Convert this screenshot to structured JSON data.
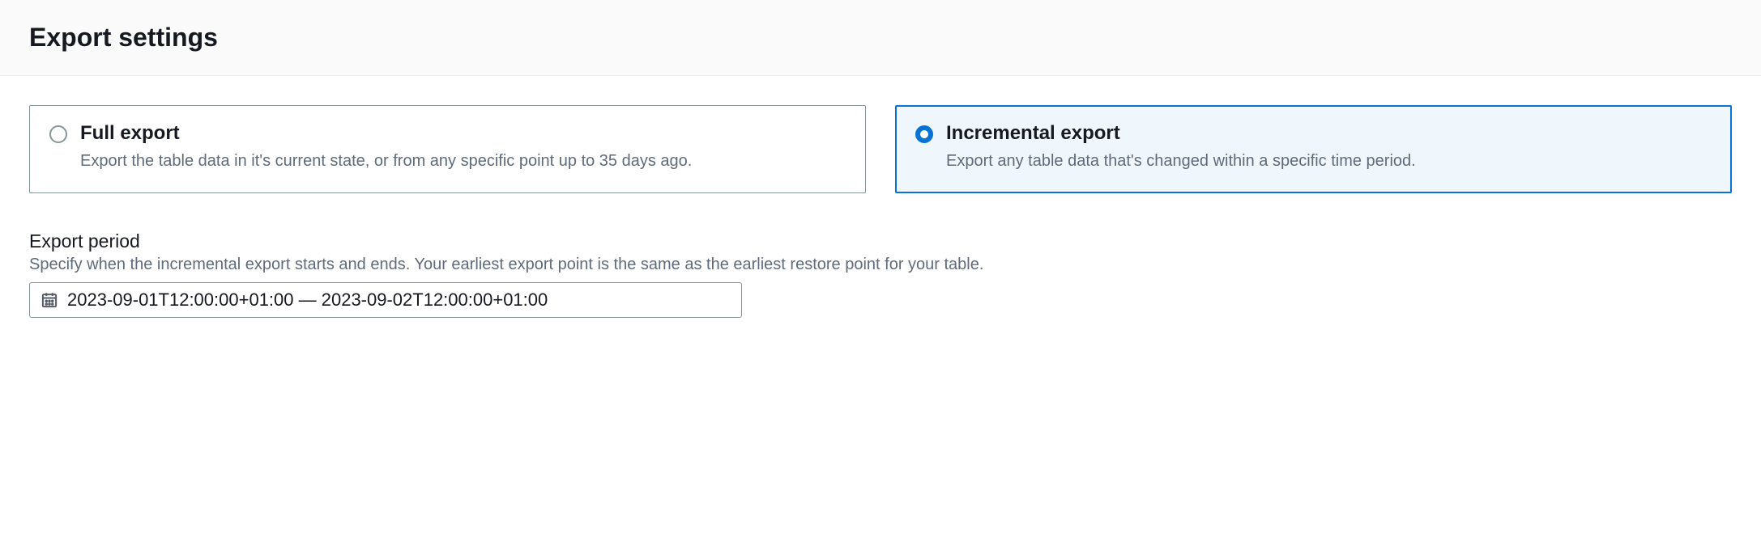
{
  "header": {
    "title": "Export settings"
  },
  "exportType": {
    "options": [
      {
        "id": "full",
        "title": "Full export",
        "description": "Export the table data in it's current state, or from any specific point up to 35 days ago.",
        "selected": false
      },
      {
        "id": "incremental",
        "title": "Incremental export",
        "description": "Export any table data that's changed within a specific time period.",
        "selected": true
      }
    ]
  },
  "exportPeriod": {
    "label": "Export period",
    "help": "Specify when the incremental export starts and ends. Your earliest export point is the same as the earliest restore point for your table.",
    "value": "2023-09-01T12:00:00+01:00 — 2023-09-02T12:00:00+01:00"
  }
}
